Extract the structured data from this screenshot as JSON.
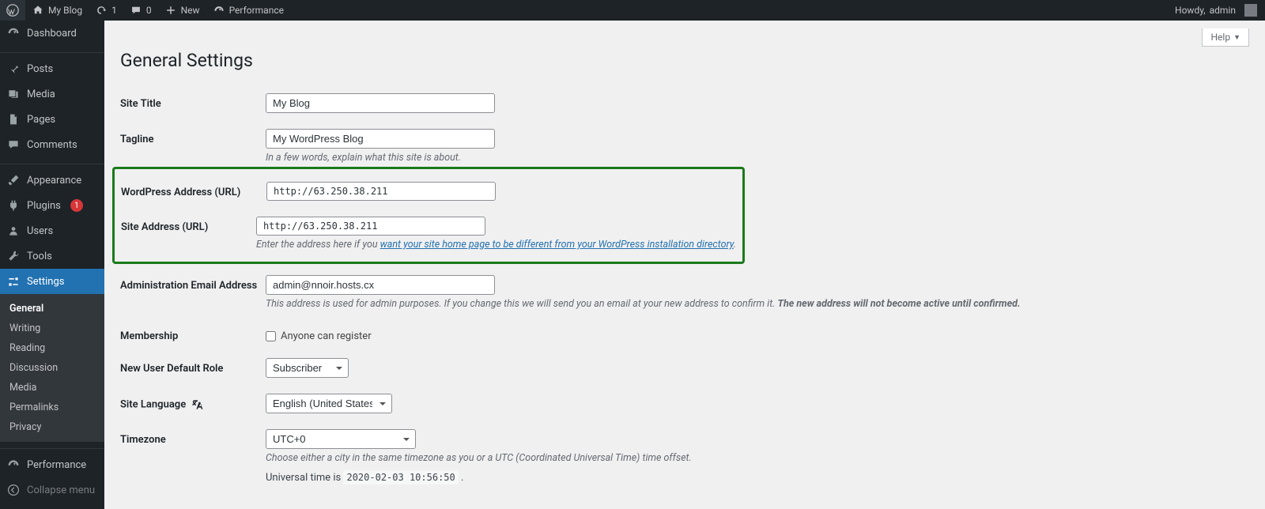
{
  "adminbar": {
    "site_name": "My Blog",
    "updates_count": "1",
    "comments_count": "0",
    "new_label": "New",
    "perf_label": "Performance",
    "howdy_prefix": "Howdy, ",
    "user": "admin"
  },
  "sidebar": {
    "dashboard": "Dashboard",
    "posts": "Posts",
    "media": "Media",
    "pages": "Pages",
    "comments": "Comments",
    "appearance": "Appearance",
    "plugins": "Plugins",
    "plugins_badge": "1",
    "users": "Users",
    "tools": "Tools",
    "settings": "Settings",
    "settings_sub": {
      "general": "General",
      "writing": "Writing",
      "reading": "Reading",
      "discussion": "Discussion",
      "media": "Media",
      "permalinks": "Permalinks",
      "privacy": "Privacy"
    },
    "performance": "Performance",
    "collapse": "Collapse menu"
  },
  "page": {
    "help_label": "Help",
    "title": "General Settings"
  },
  "fields": {
    "site_title_label": "Site Title",
    "site_title_value": "My Blog",
    "tagline_label": "Tagline",
    "tagline_value": "My WordPress Blog",
    "tagline_desc": "In a few words, explain what this site is about.",
    "wp_url_label": "WordPress Address (URL)",
    "wp_url_value": "http://63.250.38.211",
    "site_url_label": "Site Address (URL)",
    "site_url_value": "http://63.250.38.211",
    "site_url_desc_prefix": "Enter the address here if you ",
    "site_url_desc_link": "want your site home page to be different from your WordPress installation directory",
    "site_url_desc_suffix": ".",
    "admin_email_label": "Administration Email Address",
    "admin_email_value": "admin@nnoir.hosts.cx",
    "admin_email_desc_1": "This address is used for admin purposes. If you change this we will send you an email at your new address to confirm it. ",
    "admin_email_desc_2": "The new address will not become active until confirmed.",
    "membership_label": "Membership",
    "membership_checkbox": "Anyone can register",
    "default_role_label": "New User Default Role",
    "default_role_value": "Subscriber",
    "language_label": "Site Language",
    "language_value": "English (United States)",
    "timezone_label": "Timezone",
    "timezone_value": "UTC+0",
    "timezone_desc": "Choose either a city in the same timezone as you or a UTC (Coordinated Universal Time) time offset.",
    "universal_prefix": "Universal time is ",
    "universal_value": "2020-02-03 10:56:50",
    "universal_suffix": " ."
  }
}
